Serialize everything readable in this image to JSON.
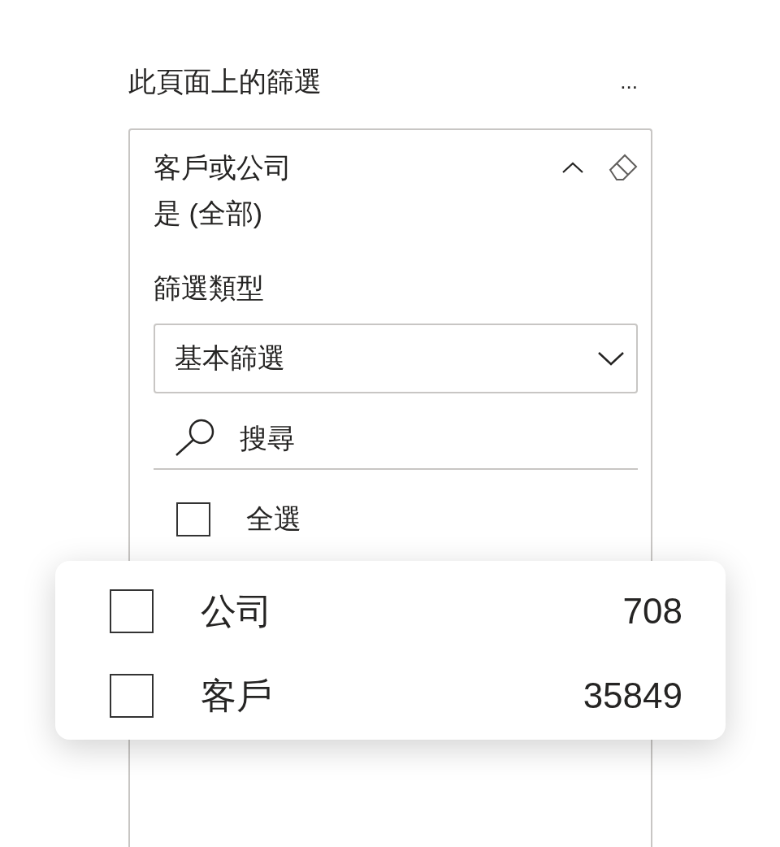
{
  "pane": {
    "title": "此頁面上的篩選",
    "more": "..."
  },
  "filter": {
    "field": "客戶或公司",
    "summary": "是 (全部)",
    "expanded": true,
    "type_label": "篩選類型",
    "type_value": "基本篩選",
    "search": {
      "placeholder": "搜尋"
    },
    "select_all": {
      "label": "全選",
      "checked": false
    }
  },
  "values": [
    {
      "label": "公司",
      "count": "708",
      "checked": false
    },
    {
      "label": "客戶",
      "count": "35849",
      "checked": false
    }
  ]
}
